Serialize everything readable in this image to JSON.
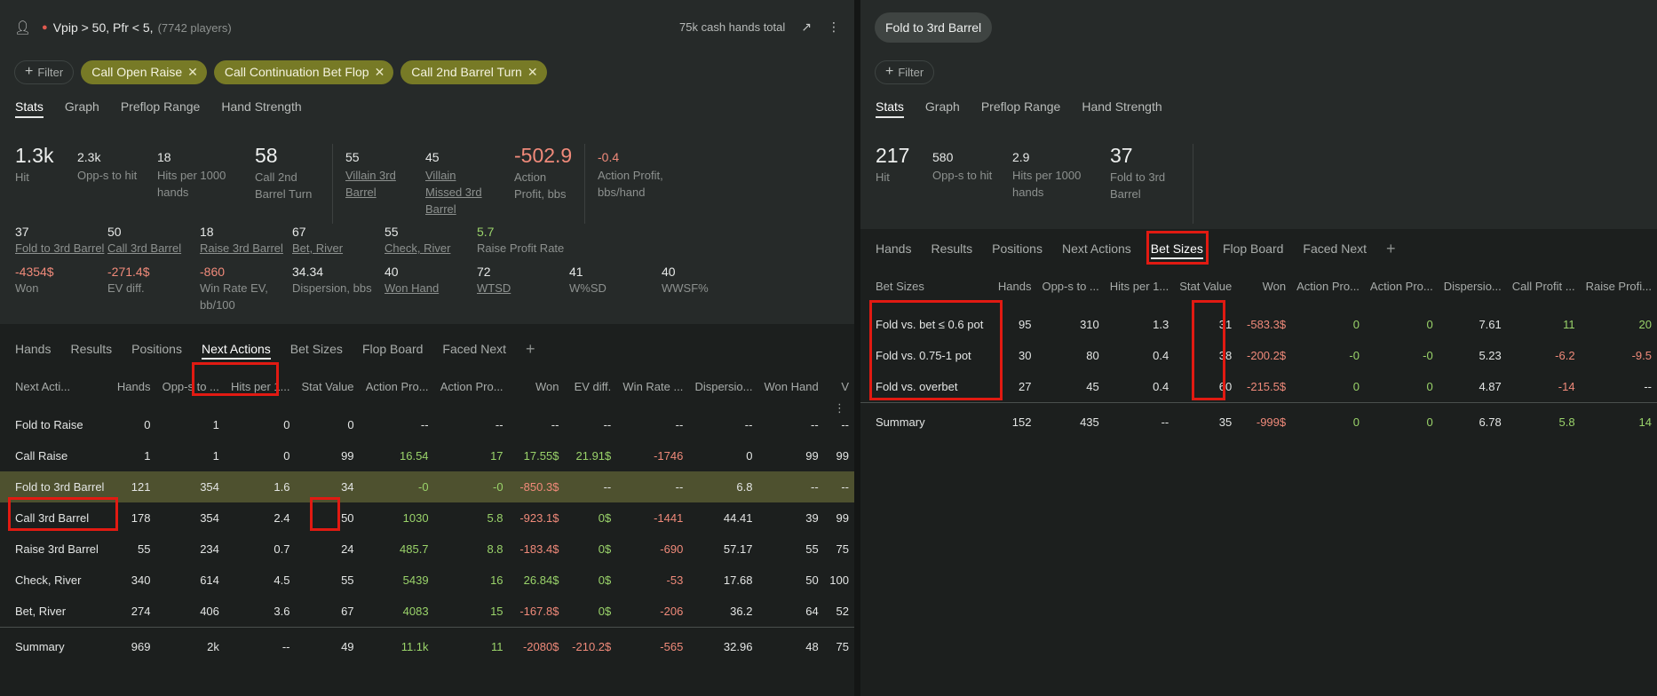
{
  "left": {
    "segment_name": "Vpip > 50, Pfr < 5,",
    "segment_count": "(7742 players)",
    "hands_total": "75k cash hands total",
    "filter_label": "Filter",
    "chips": [
      "Call Open Raise",
      "Call Continuation Bet Flop",
      "Call 2nd Barrel Turn"
    ],
    "tabs": [
      "Stats",
      "Graph",
      "Preflop Range",
      "Hand Strength"
    ],
    "stats": [
      {
        "value": "1.3k",
        "label": "Hit"
      },
      {
        "value": "2.3k",
        "label": "Opp-s to hit"
      },
      {
        "value": "18",
        "label": "Hits per 1000 hands"
      },
      {
        "value": "58",
        "label": "Call 2nd Barrel Turn"
      },
      {
        "value": "55",
        "label": "Villain 3rd Barrel"
      },
      {
        "value": "45",
        "label": "Villain Missed 3rd Barrel"
      },
      {
        "value": "-502.9",
        "label": "Action Profit, bbs"
      },
      {
        "value": "-0.4",
        "label": "Action Profit, bbs/hand"
      }
    ],
    "mini_row1": [
      {
        "value": "37",
        "label": "Fold to 3rd Barrel"
      },
      {
        "value": "50",
        "label": "Call 3rd Barrel"
      },
      {
        "value": "18",
        "label": "Raise 3rd Barrel"
      },
      {
        "value": "67",
        "label": "Bet, River"
      },
      {
        "value": "55",
        "label": "Check, River"
      },
      {
        "value": "5.7",
        "label": "Raise Profit Rate"
      }
    ],
    "mini_row2": [
      {
        "value": "-4354$",
        "label": "Won"
      },
      {
        "value": "-271.4$",
        "label": "EV diff."
      },
      {
        "value": "-860",
        "label": "Win Rate EV, bb/100"
      },
      {
        "value": "34.34",
        "label": "Dispersion, bbs"
      },
      {
        "value": "40",
        "label": "Won Hand"
      },
      {
        "value": "72",
        "label": "WTSD"
      },
      {
        "value": "41",
        "label": "W%SD"
      },
      {
        "value": "40",
        "label": "WWSF%"
      }
    ],
    "subtabs": [
      "Hands",
      "Results",
      "Positions",
      "Next Actions",
      "Bet Sizes",
      "Flop Board",
      "Faced Next"
    ],
    "table_headers": [
      "Next Acti...",
      "Hands",
      "Opp-s to ...",
      "Hits per 1...",
      "Stat Value",
      "Action Pro...",
      "Action Pro...",
      "Won",
      "EV diff.",
      "Win Rate ...",
      "Dispersio...",
      "Won Hand",
      "V"
    ],
    "rows": [
      [
        "Fold to Raise",
        "0",
        "1",
        "0",
        "0",
        "--",
        "--",
        "--",
        "--",
        "--",
        "--",
        "--",
        "--"
      ],
      [
        "Call Raise",
        "1",
        "1",
        "0",
        "99",
        "16.54",
        "17",
        "17.55$",
        "21.91$",
        "-1746",
        "0",
        "99",
        "99"
      ],
      [
        "Fold to 3rd Barrel",
        "121",
        "354",
        "1.6",
        "34",
        "-0",
        "-0",
        "-850.3$",
        "--",
        "--",
        "6.8",
        "--",
        "--"
      ],
      [
        "Call 3rd Barrel",
        "178",
        "354",
        "2.4",
        "50",
        "1030",
        "5.8",
        "-923.1$",
        "0$",
        "-1441",
        "44.41",
        "39",
        "99"
      ],
      [
        "Raise 3rd Barrel",
        "55",
        "234",
        "0.7",
        "24",
        "485.7",
        "8.8",
        "-183.4$",
        "0$",
        "-690",
        "57.17",
        "55",
        "75"
      ],
      [
        "Check, River",
        "340",
        "614",
        "4.5",
        "55",
        "5439",
        "16",
        "26.84$",
        "0$",
        "-53",
        "17.68",
        "50",
        "100"
      ],
      [
        "Bet, River",
        "274",
        "406",
        "3.6",
        "67",
        "4083",
        "15",
        "-167.8$",
        "0$",
        "-206",
        "36.2",
        "64",
        "52"
      ]
    ],
    "summary": [
      "Summary",
      "969",
      "2k",
      "--",
      "49",
      "11.1k",
      "11",
      "-2080$",
      "-210.2$",
      "-565",
      "32.96",
      "48",
      "75"
    ]
  },
  "right": {
    "title": "Fold to 3rd Barrel",
    "filter_label": "Filter",
    "tabs": [
      "Stats",
      "Graph",
      "Preflop Range",
      "Hand Strength"
    ],
    "stats": [
      {
        "value": "217",
        "label": "Hit"
      },
      {
        "value": "580",
        "label": "Opp-s to hit"
      },
      {
        "value": "2.9",
        "label": "Hits per 1000 hands"
      },
      {
        "value": "37",
        "label": "Fold to 3rd Barrel"
      }
    ],
    "subtabs": [
      "Hands",
      "Results",
      "Positions",
      "Next Actions",
      "Bet Sizes",
      "Flop Board",
      "Faced Next"
    ],
    "table_headers": [
      "Bet Sizes",
      "Hands",
      "Opp-s to ...",
      "Hits per 1...",
      "Stat Value",
      "Won",
      "Action Pro...",
      "Action Pro...",
      "Dispersio...",
      "Call Profit ...",
      "Raise Profi..."
    ],
    "rows": [
      [
        "Fold vs. bet ≤ 0.6 pot",
        "95",
        "310",
        "1.3",
        "31",
        "-583.3$",
        "0",
        "0",
        "7.61",
        "11",
        "20"
      ],
      [
        "Fold vs. 0.75-1 pot",
        "30",
        "80",
        "0.4",
        "38",
        "-200.2$",
        "-0",
        "-0",
        "5.23",
        "-6.2",
        "-9.5"
      ],
      [
        "Fold vs. overbet",
        "27",
        "45",
        "0.4",
        "60",
        "-215.5$",
        "0",
        "0",
        "4.87",
        "-14",
        "--"
      ]
    ],
    "summary": [
      "Summary",
      "152",
      "435",
      "--",
      "35",
      "-999$",
      "0",
      "0",
      "6.78",
      "5.8",
      "14"
    ]
  }
}
